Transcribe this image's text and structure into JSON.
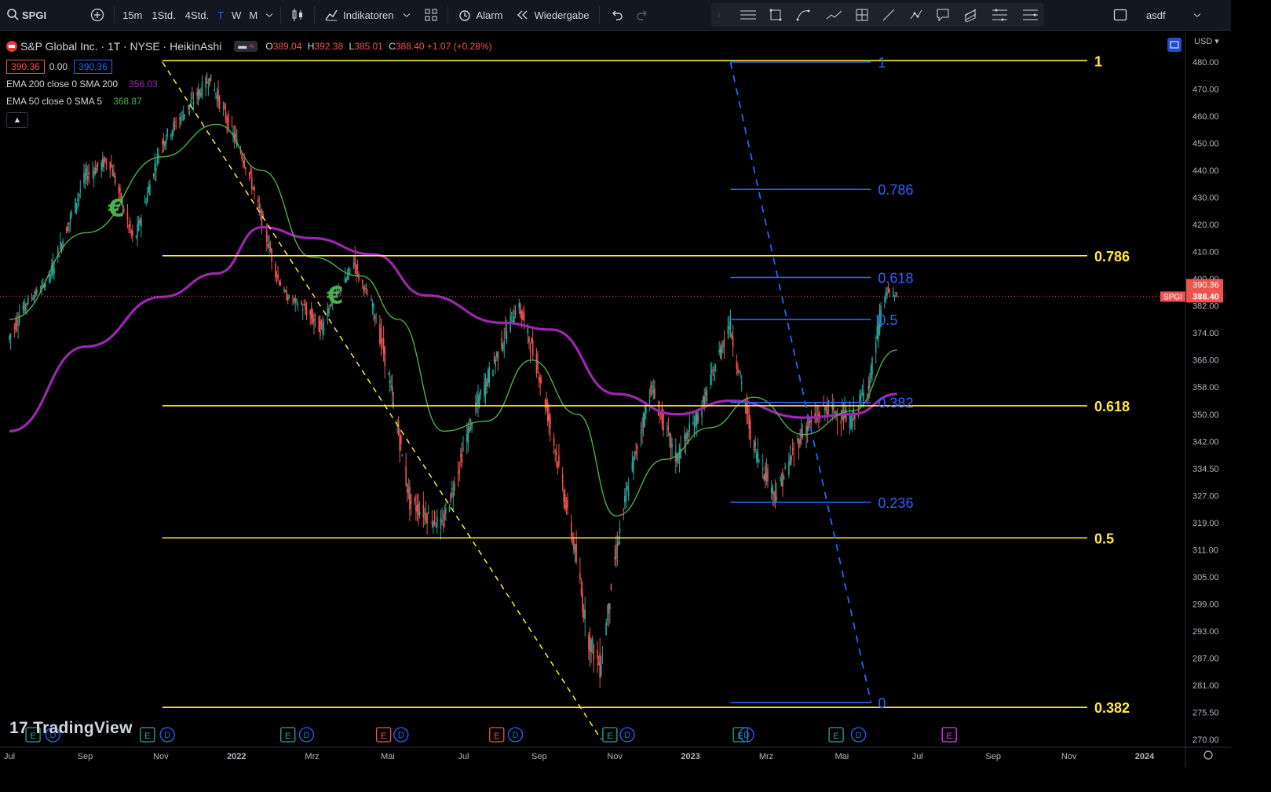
{
  "toolbar": {
    "symbol": "SPGI",
    "intervals": [
      "15m",
      "1Std.",
      "4Std.",
      "T",
      "W",
      "M"
    ],
    "indicators_label": "Indikatoren",
    "alert_label": "Alarm",
    "replay_label": "Wiedergabe",
    "layout_name": "asdf"
  },
  "legend": {
    "title": "S&P Global Inc. · 1T · NYSE · HeikinAshi",
    "ohlc": [
      {
        "k": "O",
        "v": "389.04"
      },
      {
        "k": "H",
        "v": "392.38"
      },
      {
        "k": "L",
        "v": "385.01"
      },
      {
        "k": "C",
        "v": "388.40 +1.07 (+0.28%)"
      }
    ],
    "bid": "390.36",
    "spread": "0.00",
    "ask": "390.36",
    "ema200_label": "EMA 200 close 0 SMA 200",
    "ema200_value": "356.03",
    "ema50_label": "EMA 50 close 0 SMA 5",
    "ema50_value": "368.87"
  },
  "branding": "TradingView",
  "currency": "USD",
  "price_markers": {
    "symbol": "SPGI",
    "upper": "390.36",
    "lower": "388.40"
  },
  "colors": {
    "up": "#26a69a",
    "down": "#ef5350",
    "ema200": "#9c27b0",
    "ema50": "#4caf50",
    "fib_yellow": "#ffeb3b",
    "fib_blue": "#2962ff",
    "bg": "#000000"
  },
  "chart_data": {
    "type": "candlestick",
    "y_ticks": [
      480,
      470,
      460,
      450,
      440,
      430,
      420,
      410,
      400,
      382,
      374,
      366,
      358,
      350,
      342,
      334.5,
      327,
      319,
      311,
      305,
      299,
      293,
      287,
      281,
      275.5,
      270
    ],
    "x_ticks": [
      "Jul",
      "Sep",
      "Nov",
      "2022",
      "Mrz",
      "Mai",
      "Jul",
      "Sep",
      "Nov",
      "2023",
      "Mrz",
      "Mai",
      "Jul",
      "Sep",
      "Nov",
      "2024"
    ],
    "price_path": [
      [
        "2021-07-01",
        372
      ],
      [
        "2021-08-01",
        398
      ],
      [
        "2021-09-01",
        438
      ],
      [
        "2021-09-20",
        444
      ],
      [
        "2021-10-10",
        413
      ],
      [
        "2021-11-01",
        450
      ],
      [
        "2021-12-10",
        474
      ],
      [
        "2022-01-10",
        440
      ],
      [
        "2022-02-10",
        388
      ],
      [
        "2022-03-10",
        375
      ],
      [
        "2022-04-05",
        407
      ],
      [
        "2022-05-01",
        365
      ],
      [
        "2022-05-20",
        325
      ],
      [
        "2022-06-15",
        318
      ],
      [
        "2022-07-10",
        350
      ],
      [
        "2022-08-15",
        383
      ],
      [
        "2022-09-01",
        362
      ],
      [
        "2022-09-15",
        338
      ],
      [
        "2022-10-10",
        292
      ],
      [
        "2022-10-20",
        285
      ],
      [
        "2022-11-10",
        327
      ],
      [
        "2022-11-30",
        358
      ],
      [
        "2022-12-20",
        337
      ],
      [
        "2023-01-10",
        352
      ],
      [
        "2023-02-01",
        377
      ],
      [
        "2023-02-20",
        341
      ],
      [
        "2023-03-10",
        327
      ],
      [
        "2023-04-01",
        345
      ],
      [
        "2023-04-20",
        352
      ],
      [
        "2023-05-10",
        348
      ],
      [
        "2023-05-25",
        360
      ],
      [
        "2023-06-08",
        392
      ],
      [
        "2023-06-15",
        388.4
      ]
    ],
    "ema200_path": [
      [
        "2021-07-01",
        345
      ],
      [
        "2021-09-01",
        370
      ],
      [
        "2021-11-01",
        388
      ],
      [
        "2021-12-15",
        402
      ],
      [
        "2022-01-20",
        419
      ],
      [
        "2022-03-01",
        415
      ],
      [
        "2022-04-20",
        409
      ],
      [
        "2022-06-01",
        389
      ],
      [
        "2022-08-01",
        377
      ],
      [
        "2022-09-10",
        375
      ],
      [
        "2022-11-01",
        356
      ],
      [
        "2022-12-20",
        350
      ],
      [
        "2023-02-01",
        354
      ],
      [
        "2023-04-01",
        349
      ],
      [
        "2023-05-10",
        350
      ],
      [
        "2023-06-15",
        356
      ]
    ],
    "ema50_path": [
      [
        "2021-07-01",
        378
      ],
      [
        "2021-09-01",
        417
      ],
      [
        "2021-11-01",
        445
      ],
      [
        "2021-12-15",
        457
      ],
      [
        "2022-01-20",
        440
      ],
      [
        "2022-03-01",
        408
      ],
      [
        "2022-04-10",
        401
      ],
      [
        "2022-05-10",
        378
      ],
      [
        "2022-06-15",
        345
      ],
      [
        "2022-07-20",
        348
      ],
      [
        "2022-08-25",
        366
      ],
      [
        "2022-10-01",
        350
      ],
      [
        "2022-11-01",
        321
      ],
      [
        "2022-12-10",
        337
      ],
      [
        "2023-01-15",
        346
      ],
      [
        "2023-02-20",
        355
      ],
      [
        "2023-04-01",
        344
      ],
      [
        "2023-05-10",
        351
      ],
      [
        "2023-06-15",
        369
      ]
    ],
    "fib_retracement_yellow": {
      "trend_start": [
        "2021-11-01",
        480
      ],
      "trend_end": [
        "2022-10-20",
        270
      ],
      "levels": [
        {
          "label": "1",
          "price": 480.5
        },
        {
          "label": "0.786",
          "price": 408.5
        },
        {
          "label": "0.618",
          "price": 352.5
        },
        {
          "label": "0.5",
          "price": 314.5
        },
        {
          "label": "0.382",
          "price": 276.5
        }
      ]
    },
    "fib_retracement_blue": {
      "trend_start": [
        "2023-02-01",
        480
      ],
      "trend_end": [
        "2023-05-25",
        277.5
      ],
      "levels": [
        {
          "label": "1",
          "price": 480
        },
        {
          "label": "0.786",
          "price": 433
        },
        {
          "label": "0.618",
          "price": 400.5
        },
        {
          "label": "0.5",
          "price": 378
        },
        {
          "label": "0.382",
          "price": 353.5
        },
        {
          "label": "0.236",
          "price": 325
        },
        {
          "label": "0",
          "price": 277.5
        }
      ]
    },
    "event_markers": [
      {
        "date": "2021-07-20",
        "type": "E"
      },
      {
        "date": "2021-08-05",
        "type": "D"
      },
      {
        "date": "2021-10-20",
        "type": "E"
      },
      {
        "date": "2021-11-05",
        "type": "D"
      },
      {
        "date": "2022-02-10",
        "type": "E"
      },
      {
        "date": "2022-02-25",
        "type": "D"
      },
      {
        "date": "2022-04-28",
        "type": "E"
      },
      {
        "date": "2022-05-12",
        "type": "D"
      },
      {
        "date": "2022-07-28",
        "type": "E"
      },
      {
        "date": "2022-08-12",
        "type": "D"
      },
      {
        "date": "2022-10-27",
        "type": "E"
      },
      {
        "date": "2022-11-10",
        "type": "D"
      },
      {
        "date": "2023-02-09",
        "type": "E"
      },
      {
        "date": "2023-02-14",
        "type": "D"
      },
      {
        "date": "2023-04-27",
        "type": "E"
      },
      {
        "date": "2023-05-15",
        "type": "D"
      },
      {
        "date": "2023-07-27",
        "type": "E"
      }
    ],
    "dividend_icons": [
      [
        "2021-09-25",
        426
      ],
      [
        "2022-03-20",
        389
      ]
    ]
  }
}
